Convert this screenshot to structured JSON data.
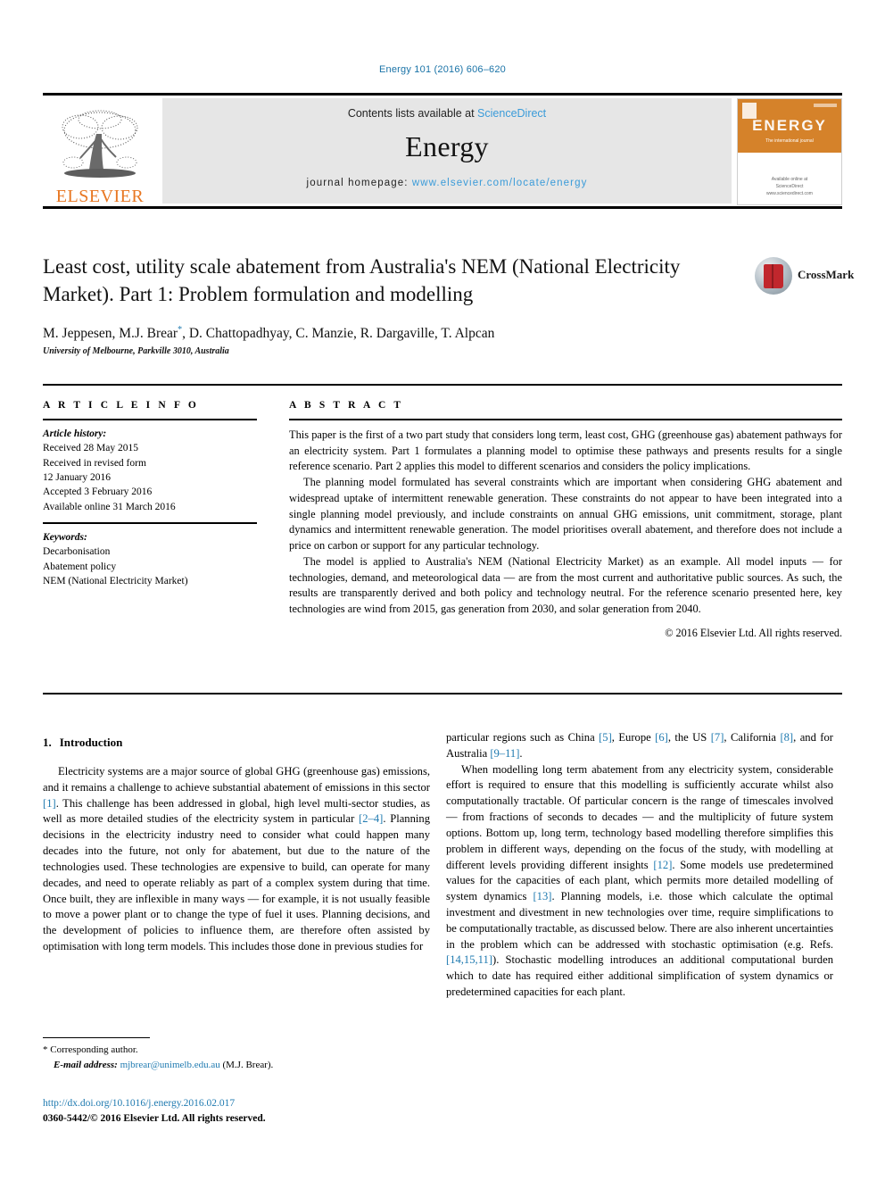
{
  "running_head": "Energy 101 (2016) 606–620",
  "banner": {
    "publisher_logo_text": "ELSEVIER",
    "contents_prefix": "Contents lists available at ",
    "contents_link": "ScienceDirect",
    "journal_name": "Energy",
    "homepage_prefix": "journal homepage: ",
    "homepage_url": "www.elsevier.com/locate/energy",
    "cover": {
      "title": "ENERGY",
      "subtitle": "The international journal",
      "footer_line1": "Available online at",
      "footer_line2": "ScienceDirect",
      "footer_line3": "www.sciencedirect.com"
    }
  },
  "article": {
    "title": "Least cost, utility scale abatement from Australia's NEM (National Electricity Market). Part 1: Problem formulation and modelling",
    "authors_pre": "M. Jeppesen, M.J. Brear",
    "authors_post": ", D. Chattopadhyay, C. Manzie, R. Dargaville, T. Alpcan",
    "author_marker": "*",
    "affiliation": "University of Melbourne, Parkville 3010, Australia",
    "crossmark_label": "CrossMark"
  },
  "article_info": {
    "heading": "A R T I C L E   I N F O",
    "history_label": "Article history:",
    "history": [
      "Received 28 May 2015",
      "Received in revised form",
      "12 January 2016",
      "Accepted 3 February 2016",
      "Available online 31 March 2016"
    ],
    "keywords_label": "Keywords:",
    "keywords": [
      "Decarbonisation",
      "Abatement policy",
      "NEM (National Electricity Market)"
    ]
  },
  "abstract": {
    "heading": "A B S T R A C T",
    "paragraphs": [
      "This paper is the first of a two part study that considers long term, least cost, GHG (greenhouse gas) abatement pathways for an electricity system. Part 1 formulates a planning model to optimise these pathways and presents results for a single reference scenario. Part 2 applies this model to different scenarios and considers the policy implications.",
      "The planning model formulated has several constraints which are important when considering GHG abatement and widespread uptake of intermittent renewable generation. These constraints do not appear to have been integrated into a single planning model previously, and include constraints on annual GHG emissions, unit commitment, storage, plant dynamics and intermittent renewable generation. The model prioritises overall abatement, and therefore does not include a price on carbon or support for any particular technology.",
      "The model is applied to Australia's NEM (National Electricity Market) as an example. All model inputs — for technologies, demand, and meteorological data — are from the most current and authoritative public sources. As such, the results are transparently derived and both policy and technology neutral. For the reference scenario presented here, key technologies are wind from 2015, gas generation from 2030, and solar generation from 2040."
    ],
    "copyright": "© 2016 Elsevier Ltd. All rights reserved."
  },
  "body": {
    "section_number": "1.",
    "section_title": "Introduction",
    "left_paragraph_html": "Electricity systems are a major source of global GHG (greenhouse gas) emissions, and it remains a challenge to achieve substantial abatement of emissions in this sector <span class=\"ref\">[1]</span>. This challenge has been addressed in global, high level multi-sector studies, as well as more detailed studies of the electricity system in particular <span class=\"ref\">[2–4]</span>. Planning decisions in the electricity industry need to consider what could happen many decades into the future, not only for abatement, but due to the nature of the technologies used. These technologies are expensive to build, can operate for many decades, and need to operate reliably as part of a complex system during that time. Once built, they are inflexible in many ways — for example, it is not usually feasible to move a power plant or to change the type of fuel it uses. Planning decisions, and the development of policies to influence them, are therefore often assisted by optimisation with long term models. This includes those done in previous studies for",
    "right_paragraph_1_html": "particular regions such as China <span class=\"ref\">[5]</span>, Europe <span class=\"ref\">[6]</span>, the US <span class=\"ref\">[7]</span>, California <span class=\"ref\">[8]</span>, and for Australia <span class=\"ref\">[9–11]</span>.",
    "right_paragraph_2_html": "When modelling long term abatement from any electricity system, considerable effort is required to ensure that this modelling is sufficiently accurate whilst also computationally tractable. Of particular concern is the range of timescales involved — from fractions of seconds to decades — and the multiplicity of future system options. Bottom up, long term, technology based modelling therefore simplifies this problem in different ways, depending on the focus of the study, with modelling at different levels providing different insights <span class=\"ref\">[12]</span>. Some models use predetermined values for the capacities of each plant, which permits more detailed modelling of system dynamics <span class=\"ref\">[13]</span>. Planning models, i.e. those which calculate the optimal investment and divestment in new technologies over time, require simplifications to be computationally tractable, as discussed below. There are also inherent uncertainties in the problem which can be addressed with stochastic optimisation (e.g. Refs. <span class=\"ref\">[14,15,11]</span>). Stochastic modelling introduces an additional computational burden which to date has required either additional simplification of system dynamics or predetermined capacities for each plant."
  },
  "footer": {
    "corresponding_marker": "*",
    "corresponding_label": "Corresponding author.",
    "email_label": "E-mail address:",
    "email": "mjbrear@unimelb.edu.au",
    "email_owner": "(M.J. Brear).",
    "doi_url": "http://dx.doi.org/10.1016/j.energy.2016.02.017",
    "issn_line": "0360-5442/© 2016 Elsevier Ltd. All rights reserved."
  },
  "colors": {
    "link_blue": "#1f7ab0",
    "sciencedirect_blue": "#3a9bd9",
    "elsevier_orange": "#e87722",
    "cover_orange": "#d5822a"
  }
}
